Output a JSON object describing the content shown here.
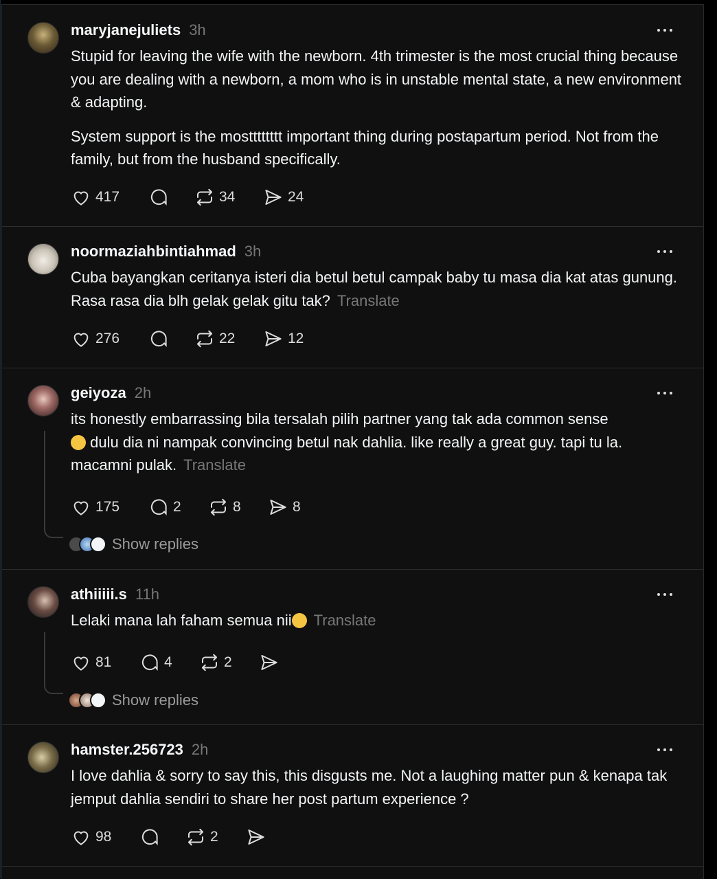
{
  "posts": [
    {
      "username": "maryjanejuliets",
      "time": "3h",
      "paragraphs": [
        "Stupid for leaving the wife with the newborn. 4th trimester is the most crucial thing because you are dealing with a newborn, a mom who is in unstable mental state, a new environment & adapting.",
        "System support is the mostttttttt important thing during postapartum period. Not from the family, but from the husband specifically."
      ],
      "likes": "417",
      "comments": "",
      "reposts": "34",
      "shares": "24"
    },
    {
      "username": "noormaziahbintiahmad",
      "time": "3h",
      "paragraphs": [
        "Cuba bayangkan ceritanya isteri dia betul betul campak baby tu masa dia kat atas gunung. Rasa rasa dia blh gelak gelak gitu tak?"
      ],
      "translate": "Translate",
      "likes": "276",
      "comments": "",
      "reposts": "22",
      "shares": "12"
    },
    {
      "username": "geiyoza",
      "time": "2h",
      "paragraphs": [
        "its honestly embarrassing bila tersalah pilih partner yang tak ada common sense",
        " dulu dia ni nampak convincing betul nak dahlia. like really a great guy. tapi tu la. macamni pulak."
      ],
      "translate": "Translate",
      "likes": "175",
      "comments": "2",
      "reposts": "8",
      "shares": "8",
      "show_replies": "Show replies"
    },
    {
      "username": "athiiiii.s",
      "time": "11h",
      "paragraphs": [
        "Lelaki mana lah faham semua nii"
      ],
      "translate": "Translate",
      "likes": "81",
      "comments": "4",
      "reposts": "2",
      "shares": "",
      "show_replies": "Show replies"
    },
    {
      "username": "hamster.256723",
      "time": "2h",
      "paragraphs": [
        "I love dahlia & sorry to say this, this disgusts me. Not a laughing matter pun & kenapa tak jemput dahlia sendiri to share her post partum experience ?"
      ],
      "likes": "98",
      "comments": "",
      "reposts": "2",
      "shares": ""
    }
  ],
  "icons": {
    "like": "heart-icon",
    "comment": "comment-bubble-icon",
    "repost": "repost-icon",
    "share": "share-send-icon",
    "more": "more-horizontal-icon"
  },
  "colors": {
    "background": "#101010",
    "text": "#f3f5f7",
    "muted": "#777777",
    "divider": "#2d2d2d"
  }
}
